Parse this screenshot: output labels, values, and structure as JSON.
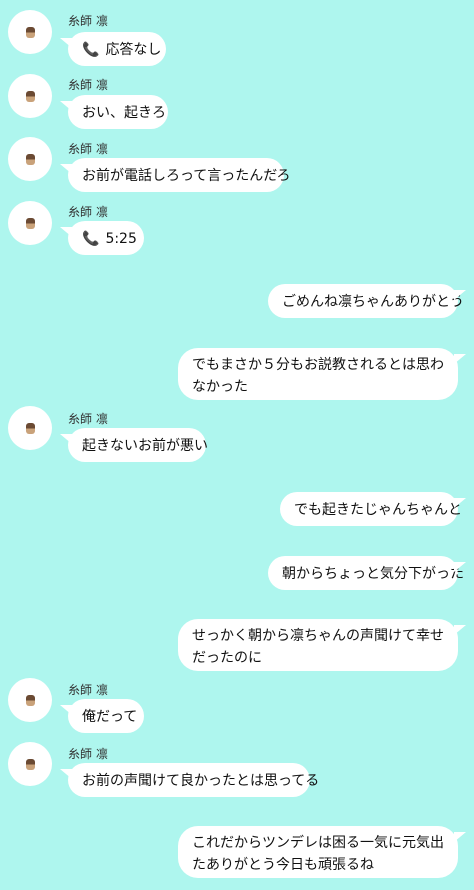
{
  "contact": {
    "name": "糸師 凛"
  },
  "icons": {
    "avatar": "avatar-image",
    "phone": "phone-icon",
    "phone_glyph": "📞"
  },
  "messages": [
    {
      "side": "left",
      "name": "糸師 凛",
      "text": "応答なし",
      "phone": true
    },
    {
      "side": "left",
      "name": "糸師 凛",
      "text": "おい、起きろ"
    },
    {
      "side": "left",
      "name": "糸師 凛",
      "text": "お前が電話しろって言ったんだろ"
    },
    {
      "side": "left",
      "name": "糸師 凛",
      "text": "5:25",
      "phone": true
    },
    {
      "side": "right",
      "text": "ごめんね凛ちゃんありがとう"
    },
    {
      "side": "right",
      "text": "でもまさか５分もお説教されるとは思わなかった"
    },
    {
      "side": "left",
      "name": "糸師 凛",
      "text": "起きないお前が悪い"
    },
    {
      "side": "right",
      "text": "でも起きたじゃんちゃんと"
    },
    {
      "side": "right",
      "text": "朝からちょっと気分下がった"
    },
    {
      "side": "right",
      "text": "せっかく朝から凛ちゃんの声聞けて幸せだったのに"
    },
    {
      "side": "left",
      "name": "糸師 凛",
      "text": "俺だって"
    },
    {
      "side": "left",
      "name": "糸師 凛",
      "text": "お前の声聞けて良かったとは思ってる"
    },
    {
      "side": "right",
      "text": "これだからツンデレは困る一気に元気出たありがとう今日も頑張るね"
    }
  ]
}
